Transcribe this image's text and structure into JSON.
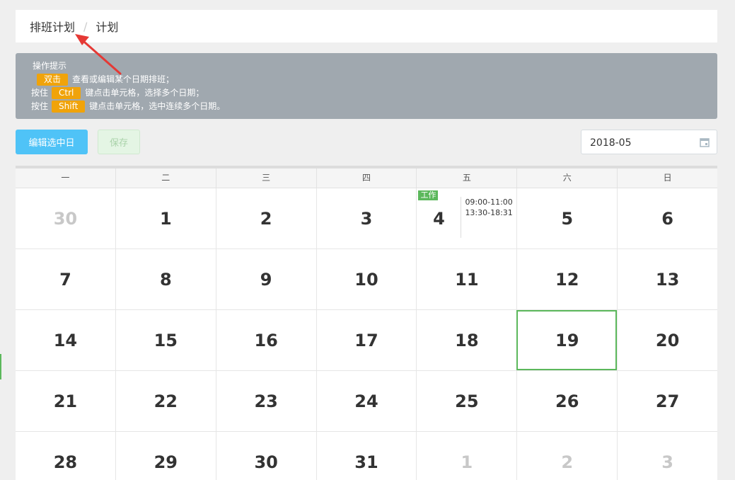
{
  "breadcrumb": {
    "root": "排班计划",
    "separator": "/",
    "current": "计划"
  },
  "tips": {
    "title": "操作提示",
    "lines": [
      {
        "prefix": "",
        "key": "双击",
        "text": "查看或编辑某个日期排班；"
      },
      {
        "prefix": "按住",
        "key": "Ctrl",
        "text": "键点击单元格，选择多个日期；"
      },
      {
        "prefix": "按住",
        "key": "Shift",
        "text": "键点击单元格，选中连续多个日期。"
      }
    ]
  },
  "toolbar": {
    "edit_label": "编辑选中日",
    "save_label": "保存",
    "month_value": "2018-05"
  },
  "calendar": {
    "weekdays": [
      "一",
      "二",
      "三",
      "四",
      "五",
      "六",
      "日"
    ],
    "weeks": [
      [
        {
          "d": "30",
          "other": true
        },
        {
          "d": "1"
        },
        {
          "d": "2"
        },
        {
          "d": "3"
        },
        {
          "d": "4",
          "tag": "工作",
          "times": [
            "09:00-11:00",
            "13:30-18:31"
          ]
        },
        {
          "d": "5"
        },
        {
          "d": "6"
        }
      ],
      [
        {
          "d": "7"
        },
        {
          "d": "8"
        },
        {
          "d": "9"
        },
        {
          "d": "10"
        },
        {
          "d": "11"
        },
        {
          "d": "12"
        },
        {
          "d": "13"
        }
      ],
      [
        {
          "d": "14"
        },
        {
          "d": "15"
        },
        {
          "d": "16"
        },
        {
          "d": "17"
        },
        {
          "d": "18"
        },
        {
          "d": "19",
          "selected": true
        },
        {
          "d": "20"
        }
      ],
      [
        {
          "d": "21"
        },
        {
          "d": "22"
        },
        {
          "d": "23"
        },
        {
          "d": "24"
        },
        {
          "d": "25"
        },
        {
          "d": "26"
        },
        {
          "d": "27"
        }
      ],
      [
        {
          "d": "28"
        },
        {
          "d": "29"
        },
        {
          "d": "30"
        },
        {
          "d": "31"
        },
        {
          "d": "1",
          "other": true
        },
        {
          "d": "2",
          "other": true
        },
        {
          "d": "3",
          "other": true
        }
      ]
    ]
  },
  "colors": {
    "accent": "#4fc3f7",
    "success": "#5cb85c",
    "key_badge": "#f0a30a",
    "annotation_arrow": "#e53935"
  },
  "icons": {
    "month_picker": "calendar-icon",
    "annotation": "red-arrow-icon"
  }
}
